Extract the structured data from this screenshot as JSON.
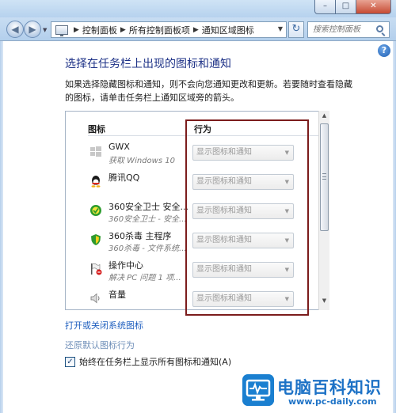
{
  "window": {
    "minimize": "–",
    "maximize": "□",
    "close": "✕"
  },
  "nav": {
    "breadcrumbs": [
      "控制面板",
      "所有控制面板项",
      "通知区域图标"
    ],
    "search_placeholder": "搜索控制面板"
  },
  "page": {
    "heading": "选择在任务栏上出现的图标和通知",
    "description": "如果选择隐藏图标和通知，则不会向您通知更改和更新。若要随时查看隐藏的图标，请单击任务栏上通知区域旁的箭头。"
  },
  "table": {
    "col_icons": "图标",
    "col_behavior": "行为",
    "rows": [
      {
        "icon": "windows-flag-icon",
        "name": "GWX",
        "sub": "获取 Windows 10",
        "behavior": "显示图标和通知"
      },
      {
        "icon": "qq-penguin-icon",
        "name": "腾讯QQ",
        "sub": "",
        "behavior": "显示图标和通知"
      },
      {
        "icon": "360-safe-icon",
        "name": "360安全卫士 安全...",
        "sub": "360安全卫士 - 安全...",
        "behavior": "显示图标和通知"
      },
      {
        "icon": "360-shield-icon",
        "name": "360杀毒 主程序",
        "sub": "360杀毒 - 文件系统...",
        "behavior": "显示图标和通知"
      },
      {
        "icon": "action-center-flag-icon",
        "name": "操作中心",
        "sub": "解决 PC 问题 1 项...",
        "behavior": "显示图标和通知"
      },
      {
        "icon": "speaker-icon",
        "name": "音量",
        "sub": "",
        "behavior": "显示图标和通知"
      }
    ]
  },
  "links": {
    "system_icons": "打开或关闭系统图标",
    "restore_defaults": "还原默认图标行为"
  },
  "always_show": {
    "label": "始终在任务栏上显示所有图标和通知(A)",
    "checked": true,
    "mark": "✓"
  },
  "watermark": {
    "title": "电脑百科知识",
    "url": "www.pc-daily.com"
  },
  "colors": {
    "heading": "#1e3287",
    "link": "#1f5fbf",
    "annotation_box": "#7b1c1c",
    "watermark": "#1d72c6"
  }
}
